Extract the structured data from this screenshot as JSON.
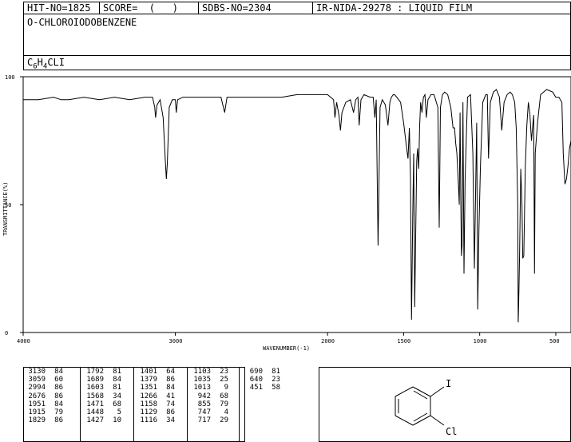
{
  "header": {
    "hit_no": "HIT-NO=1825",
    "score": "SCORE=  (   )",
    "sdbs_no": "SDBS-NO=2304",
    "ir_id": "IR-NIDA-29278 : LIQUID FILM",
    "compound_name": "O-CHLOROIODOBENZENE",
    "formula_parts": [
      "C",
      "6",
      "H",
      "4",
      "CLI"
    ]
  },
  "chart_data": {
    "type": "line",
    "xlabel": "WAVENUMBER(-1)",
    "ylabel": "TRANSMITTANCE(%)",
    "xlim": [
      4000,
      400
    ],
    "ylim": [
      0,
      100
    ],
    "x_ticks": [
      4000,
      3000,
      2000,
      1500,
      1000,
      500
    ],
    "x_tick_labels": [
      "4000",
      "3000",
      "2000",
      "1500",
      "1000",
      "500"
    ],
    "y_ticks": [
      0,
      50,
      100
    ],
    "y_tick_labels": [
      "0",
      "50",
      "100"
    ],
    "grid": false,
    "series": [
      {
        "x": [
          4000,
          3900,
          3800,
          3750,
          3700,
          3600,
          3500,
          3400,
          3300,
          3200,
          3150,
          3135,
          3130,
          3120,
          3100,
          3080,
          3065,
          3059,
          3053,
          3040,
          3020,
          3000,
          2994,
          2985,
          2950,
          2900,
          2850,
          2800,
          2700,
          2676,
          2660,
          2600,
          2500,
          2400,
          2300,
          2200,
          2100,
          2000,
          1960,
          1951,
          1940,
          1925,
          1915,
          1905,
          1880,
          1850,
          1829,
          1815,
          1800,
          1792,
          1780,
          1760,
          1720,
          1700,
          1689,
          1680,
          1668,
          1655,
          1640,
          1620,
          1603,
          1590,
          1580,
          1568,
          1560,
          1545,
          1520,
          1500,
          1480,
          1471,
          1462,
          1455,
          1448,
          1440,
          1434,
          1427,
          1420,
          1414,
          1408,
          1401,
          1395,
          1388,
          1379,
          1370,
          1360,
          1351,
          1340,
          1320,
          1300,
          1275,
          1266,
          1258,
          1245,
          1230,
          1210,
          1190,
          1175,
          1165,
          1158,
          1150,
          1140,
          1134,
          1129,
          1124,
          1120,
          1116,
          1110,
          1103,
          1096,
          1080,
          1060,
          1045,
          1035,
          1028,
          1020,
          1013,
          1005,
          995,
          980,
          960,
          950,
          942,
          930,
          910,
          890,
          870,
          855,
          840,
          820,
          800,
          785,
          770,
          760,
          750,
          747,
          744,
          738,
          730,
          722,
          717,
          710,
          700,
          690,
          680,
          670,
          660,
          650,
          645,
          640,
          635,
          620,
          600,
          560,
          520,
          500,
          480,
          460,
          451,
          440,
          430,
          420,
          410,
          400
        ],
        "y": [
          91,
          91,
          92,
          91,
          91,
          92,
          91,
          92,
          91,
          92,
          92,
          88,
          84,
          89,
          91,
          84,
          66,
          60,
          66,
          88,
          91,
          91,
          86,
          91,
          92,
          92,
          92,
          92,
          92,
          86,
          92,
          92,
          92,
          92,
          92,
          93,
          93,
          93,
          91,
          84,
          90,
          85,
          79,
          86,
          90,
          91,
          86,
          91,
          92,
          81,
          91,
          93,
          92,
          92,
          84,
          91,
          34,
          88,
          91,
          89,
          81,
          90,
          92,
          93,
          93,
          92,
          90,
          82,
          72,
          68,
          80,
          60,
          5,
          45,
          70,
          10,
          40,
          67,
          72,
          64,
          80,
          90,
          86,
          92,
          93,
          84,
          91,
          93,
          93,
          88,
          41,
          88,
          93,
          94,
          93,
          88,
          80,
          80,
          74,
          70,
          58,
          50,
          86,
          52,
          30,
          34,
          90,
          23,
          60,
          92,
          93,
          70,
          25,
          50,
          82,
          9,
          40,
          65,
          90,
          93,
          93,
          68,
          90,
          94,
          95,
          92,
          79,
          90,
          93,
          94,
          93,
          90,
          80,
          50,
          4,
          10,
          30,
          64,
          50,
          29,
          30,
          65,
          81,
          90,
          85,
          75,
          82,
          85,
          23,
          70,
          82,
          93,
          95,
          94,
          92,
          92,
          90,
          70,
          58,
          60,
          65,
          72,
          75
        ]
      }
    ]
  },
  "peak_table": [
    [
      {
        "w": "3130",
        "t": "84"
      },
      {
        "w": "3059",
        "t": "60"
      },
      {
        "w": "2994",
        "t": "86"
      },
      {
        "w": "2676",
        "t": "86"
      },
      {
        "w": "1951",
        "t": "84"
      },
      {
        "w": "1915",
        "t": "79"
      },
      {
        "w": "1829",
        "t": "86"
      }
    ],
    [
      {
        "w": "1792",
        "t": "81"
      },
      {
        "w": "1689",
        "t": "84"
      },
      {
        "w": "1603",
        "t": "81"
      },
      {
        "w": "1568",
        "t": "34"
      },
      {
        "w": "1471",
        "t": "68"
      },
      {
        "w": "1448",
        "t": "5"
      },
      {
        "w": "1427",
        "t": "10"
      }
    ],
    [
      {
        "w": "1401",
        "t": "64"
      },
      {
        "w": "1379",
        "t": "86"
      },
      {
        "w": "1351",
        "t": "84"
      },
      {
        "w": "1266",
        "t": "41"
      },
      {
        "w": "1158",
        "t": "74"
      },
      {
        "w": "1129",
        "t": "86"
      },
      {
        "w": "1116",
        "t": "34"
      }
    ],
    [
      {
        "w": "1103",
        "t": "23"
      },
      {
        "w": "1035",
        "t": "25"
      },
      {
        "w": "1013",
        "t": "9"
      },
      {
        "w": "942",
        "t": "68"
      },
      {
        "w": "855",
        "t": "79"
      },
      {
        "w": "747",
        "t": "4"
      },
      {
        "w": "717",
        "t": "29"
      }
    ],
    [
      {
        "w": "690",
        "t": "81"
      },
      {
        "w": "640",
        "t": "23"
      },
      {
        "w": "451",
        "t": "58"
      }
    ]
  ],
  "structure": {
    "substituent_1": "I",
    "substituent_2": "Cl"
  }
}
